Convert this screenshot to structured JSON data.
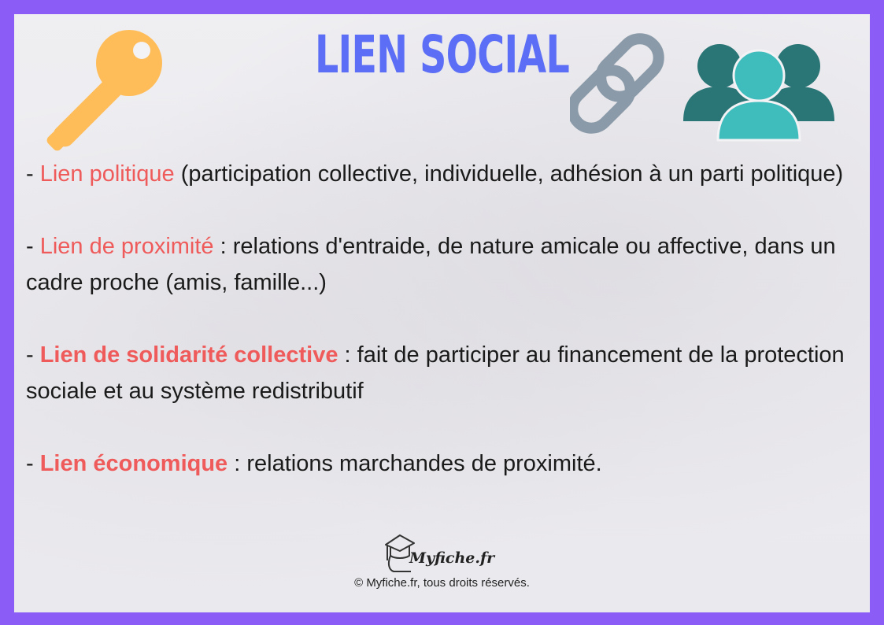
{
  "title": "LIEN SOCIAL",
  "icons": {
    "key": "key-icon",
    "chain": "chain-link-icon",
    "people": "people-group-icon",
    "logo": "graduation-cap-logo"
  },
  "colors": {
    "frame": "#8b5cf6",
    "title": "#5b6ef5",
    "term": "#ef5a5a",
    "key": "#ffbd59",
    "chain": "#8a9aa8",
    "people_back": "#2a7575",
    "people_front": "#3fbdbd"
  },
  "items": [
    {
      "prefix": "- ",
      "term": "Lien politique",
      "rest": " (participation collective, individuelle, adhésion à un parti politique)"
    },
    {
      "prefix": "- ",
      "term": "Lien de proximité",
      "rest": " : relations d'entraide, de nature amicale ou affective, dans un cadre proche (amis, famille...)"
    },
    {
      "prefix": "- ",
      "term": "Lien de solidarité collective",
      "rest": " : fait de participer au financement de la protection sociale et au système redistributif"
    },
    {
      "prefix": "- ",
      "term": "Lien économique",
      "rest": " : relations marchandes de proximité."
    }
  ],
  "footer": {
    "logo_text": "Myfiche.fr",
    "copyright": "© Myfiche.fr, tous droits réservés."
  }
}
